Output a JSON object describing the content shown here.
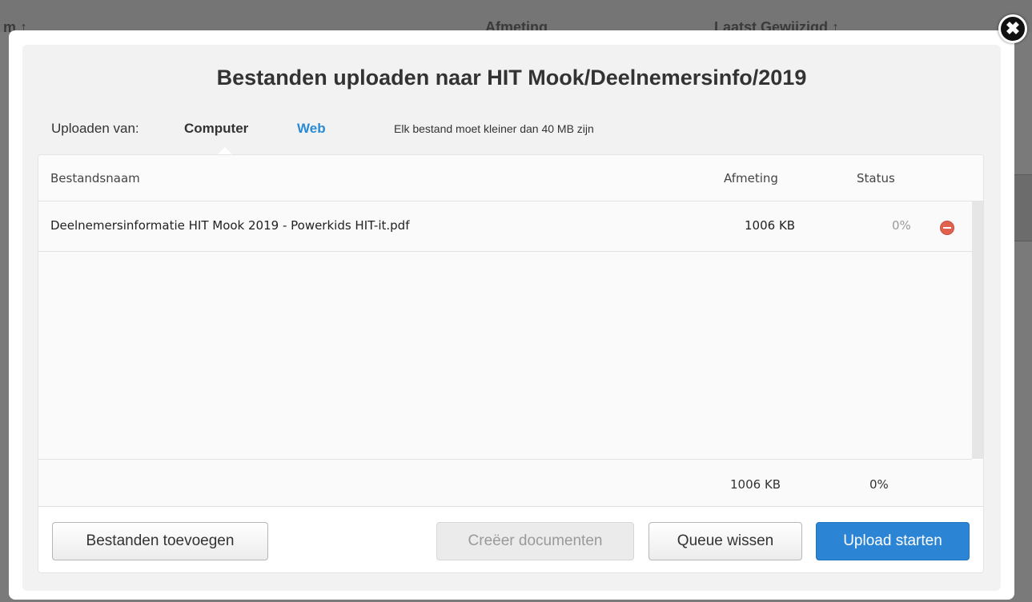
{
  "background": {
    "col_name_fragment": "m ↑",
    "col_size": "Afmeting",
    "col_modified": "Laatst Gewijzigd ↑"
  },
  "dialog": {
    "close_icon": "✖",
    "title": "Bestanden uploaden naar HIT Mook/Deelnemersinfo/2019",
    "source_label": "Uploaden van:",
    "tabs": {
      "computer": "Computer",
      "web": "Web"
    },
    "size_limit_note": "Elk bestand moet kleiner dan 40 MB zijn",
    "columns": {
      "filename": "Bestandsnaam",
      "size": "Afmeting",
      "status": "Status"
    },
    "files": [
      {
        "name": "Deelnemersinformatie HIT Mook 2019 - Powerkids HIT-it.pdf",
        "size": "1006 KB",
        "status": "0%",
        "action_icon": "remove-circle-icon"
      }
    ],
    "totals": {
      "size": "1006 KB",
      "status": "0%"
    },
    "buttons": {
      "add_files": "Bestanden toevoegen",
      "create_documents": "Creëer documenten",
      "clear_queue": "Queue wissen",
      "start_upload": "Upload starten"
    },
    "colors": {
      "accent": "#2b85d4",
      "web_tab": "#2a8ad4",
      "remove": "#e0624e"
    }
  }
}
